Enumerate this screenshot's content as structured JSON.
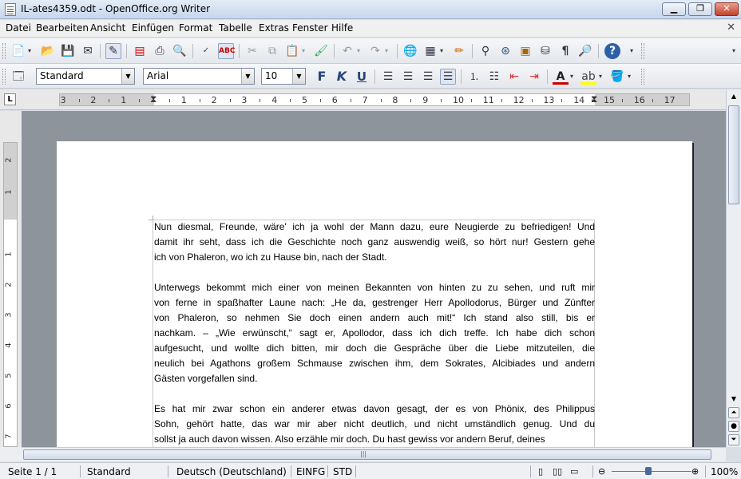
{
  "window": {
    "title": "IL-ates4359.odt - OpenOffice.org Writer"
  },
  "menu": [
    "Datei",
    "Bearbeiten",
    "Ansicht",
    "Einfügen",
    "Format",
    "Tabelle",
    "Extras",
    "Fenster",
    "Hilfe"
  ],
  "formatting": {
    "style": "Standard",
    "font": "Arial",
    "size": "10"
  },
  "ruler": {
    "h_numbers": [
      "3",
      "2",
      "1",
      "1",
      "2",
      "3",
      "4",
      "5",
      "6",
      "7",
      "8",
      "9",
      "10",
      "11",
      "12",
      "13",
      "14",
      "15",
      "16",
      "17"
    ],
    "v_numbers": [
      "2",
      "1",
      "1",
      "2",
      "3",
      "4",
      "5",
      "6",
      "7"
    ]
  },
  "document": {
    "paragraphs": [
      [
        "Nun diesmal, Freunde, wäre' ich ja wohl der Mann dazu, eure Neugierde zu befriedigen! Und",
        "damit ihr seht, dass ich die Geschichte noch ganz auswendig weiß, so hört nur! Gestern gehe",
        "ich von Phaleron, wo ich zu Hause bin, nach der Stadt."
      ],
      [
        "Unterwegs bekommt mich einer von meinen Bekannten von hinten zu zu sehen, und ruft mir",
        "von ferne in spaßhafter Laune nach: „He da, gestrenger Herr Apollodorus, Bürger und Zünfter",
        "von Phaleron, so nehmen Sie doch einen andern auch mit!“ Ich stand also still, bis er",
        "nachkam. – „Wie erwünscht,“ sagt er, Apollodor, dass ich dich treffe. Ich habe dich schon",
        "aufgesucht, und wollte dich bitten, mir doch die Gespräche über die Liebe mitzuteilen, die",
        "neulich bei Agathons großem Schmause zwischen ihm, dem Sokrates, Alcibiades und andern",
        "Gästen vorgefallen sind."
      ],
      [
        "Es hat mir zwar schon ein anderer etwas davon gesagt, der es von Phönix, des Philippus",
        "Sohn, gehört hatte, das war mir aber nicht deutlich, und nicht umständlich genug. Und du",
        "sollst ja auch davon wissen. Also erzähle mir doch. Du hast gewiss vor andern Beruf, deines"
      ]
    ]
  },
  "status": {
    "page": "Seite 1 / 1",
    "style": "Standard",
    "language": "Deutsch (Deutschland)",
    "insert": "EINFG",
    "mode": "STD",
    "zoom": "100%",
    "zoom_level_pct": 60
  },
  "icons": [
    "new-icon",
    "open-icon",
    "save-icon",
    "mail-icon",
    "edit-icon",
    "pdf-icon",
    "print-icon",
    "preview-icon",
    "spellcheck-icon",
    "autospell-icon",
    "cut-icon",
    "copy-icon",
    "paste-icon",
    "format-paintbrush-icon",
    "undo-icon",
    "redo-icon",
    "navigator-icon",
    "table-icon",
    "draw-icon",
    "find-icon",
    "gallery-icon",
    "datasource-icon",
    "nonprinting-icon",
    "zoom-icon",
    "help-icon"
  ]
}
